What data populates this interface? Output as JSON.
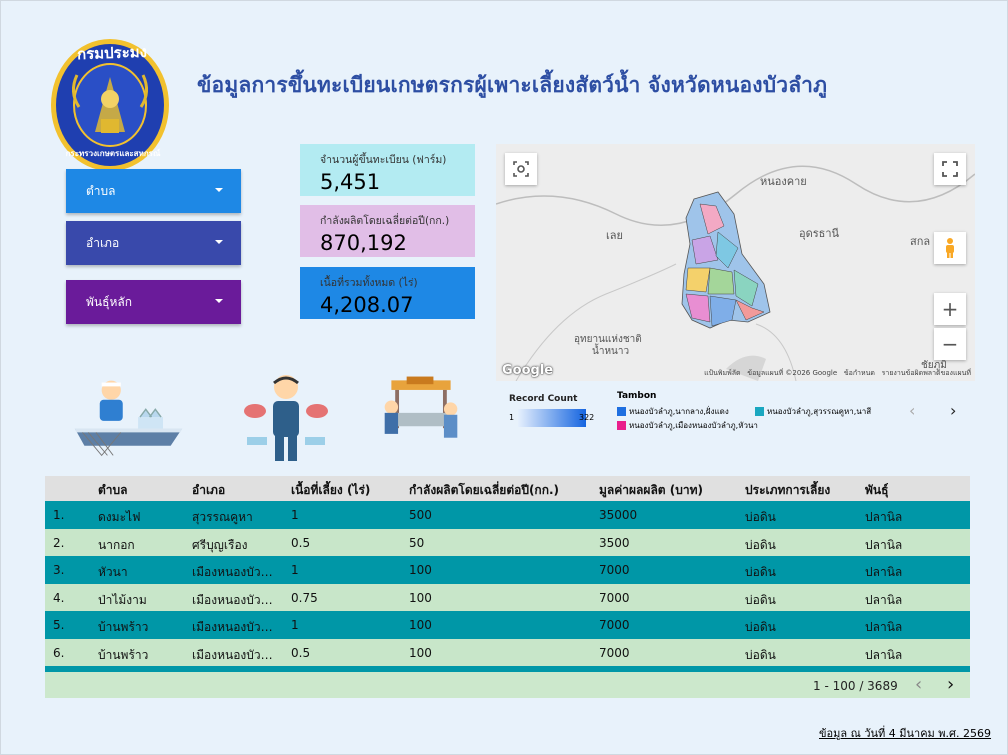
{
  "logo": {
    "top_text": "กรมประมง",
    "bottom_text": "กระทรวงเกษตรและสหกรณ์"
  },
  "title": "ข้อมูลการขึ้นทะเบียนเกษตรกรผู้เพาะเลี้ยงสัตว์น้ำ  จังหวัดหนองบัวลำภู",
  "filters": [
    {
      "label": "ตำบล",
      "color": "#1e88e5"
    },
    {
      "label": "อำเภอ",
      "color": "#3949ab"
    },
    {
      "label": "พันธุ์หลัก",
      "color": "#6a1b9a"
    }
  ],
  "kpis": [
    {
      "label": "จำนวนผู้ขึ้นทะเบียน (ฟาร์ม)",
      "value": "5,451",
      "color": "#b3ebf2"
    },
    {
      "label": "กำลังผลิตโดยเฉลี่ยต่อปี(กก.)",
      "value": "870,192",
      "color": "#e1bee7"
    },
    {
      "label": "เนื้อที่รวมทั้งหมด (ไร่)",
      "value": "4,208.07",
      "color": "#1e88e5"
    }
  ],
  "map": {
    "places": [
      "หนองคาย",
      "เลย",
      "อุดรธานี",
      "สกล",
      "อุทยานแห่งชาติ",
      "น้ำหนาว",
      "ชัยภูมิ"
    ],
    "attribution": [
      "แป้นพิมพ์ลัด",
      "ข้อมูลแผนที่ ©2026 Google",
      "ข้อกำหนด",
      "รายงานข้อผิดพลาดของแผนที่"
    ],
    "google": "Google",
    "zoom_in": "+",
    "zoom_out": "−"
  },
  "legend": {
    "record_title": "Record Count",
    "min": "1",
    "max": "322",
    "tambon_title": "Tambon",
    "items": [
      {
        "label": "หนองบัวลำภู,นากลาง,ฝั่งแดง",
        "color": "#1e6fe0"
      },
      {
        "label": "หนองบัวลำภู,สุวรรณคูหา,นาสี",
        "color": "#1aa7c0"
      },
      {
        "label": "หนองบัวลำภู,เมืองหนองบัวลำภู,หัวนา",
        "color": "#e91e8c"
      }
    ]
  },
  "table": {
    "columns": [
      "ตำบล",
      "อำเภอ",
      "เนื้อที่เลี้ยง (ไร่)",
      "กำลังผลิตโดยเฉลี่ยต่อปี(กก.)",
      "มูลค่าผลผลิต (บาท)",
      "ประเภทการเลี้ยง",
      "พันธุ์"
    ],
    "rows": [
      {
        "n": "1.",
        "tambon": "ดงมะไฟ",
        "amphoe": "สุวรรณคูหา",
        "area": "1",
        "prod": "500",
        "value": "35000",
        "type": "บ่อดิน",
        "species": "ปลานิล"
      },
      {
        "n": "2.",
        "tambon": "นากอก",
        "amphoe": "ศรีบุญเรือง",
        "area": "0.5",
        "prod": "50",
        "value": "3500",
        "type": "บ่อดิน",
        "species": "ปลานิล"
      },
      {
        "n": "3.",
        "tambon": "หัวนา",
        "amphoe": "เมืองหนองบัวลำภู",
        "area": "1",
        "prod": "100",
        "value": "7000",
        "type": "บ่อดิน",
        "species": "ปลานิล"
      },
      {
        "n": "4.",
        "tambon": "ป่าไม้งาม",
        "amphoe": "เมืองหนองบัวลำภู",
        "area": "0.75",
        "prod": "100",
        "value": "7000",
        "type": "บ่อดิน",
        "species": "ปลานิล"
      },
      {
        "n": "5.",
        "tambon": "บ้านพร้าว",
        "amphoe": "เมืองหนองบัวลำภู",
        "area": "1",
        "prod": "100",
        "value": "7000",
        "type": "บ่อดิน",
        "species": "ปลานิล"
      },
      {
        "n": "6.",
        "tambon": "บ้านพร้าว",
        "amphoe": "เมืองหนองบัวลำภู",
        "area": "0.5",
        "prod": "100",
        "value": "7000",
        "type": "บ่อดิน",
        "species": "ปลานิล"
      }
    ],
    "row_colors": [
      "#0097a7",
      "#c8e6c9"
    ],
    "pagination": "1 - 100 / 3689"
  },
  "asof": "ข้อมูล ณ วันที่ 4 มีนาคม พ.ศ. 2569"
}
